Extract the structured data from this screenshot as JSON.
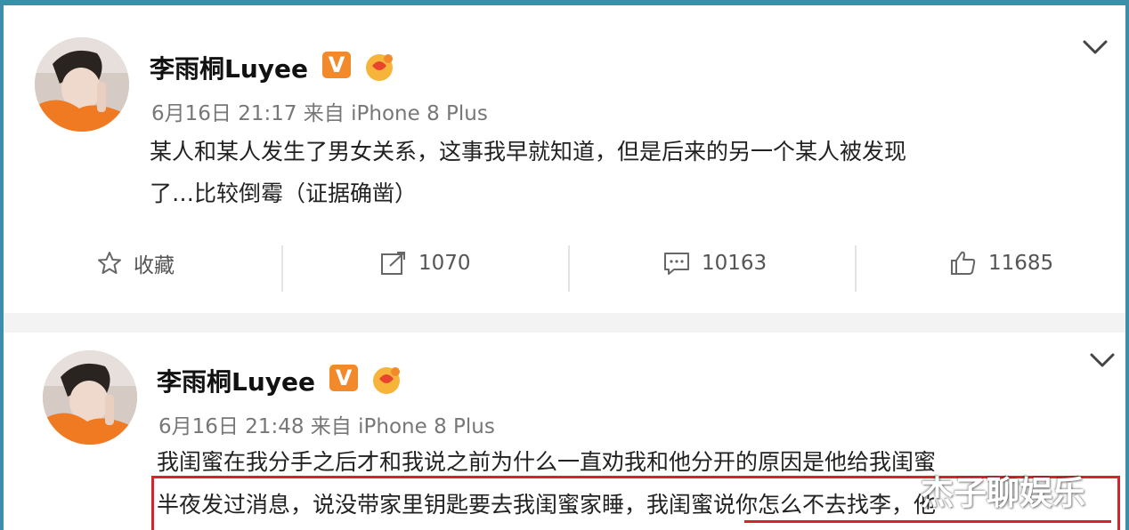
{
  "posts": [
    {
      "username": "李雨桐Luyee",
      "verified_badge": "V",
      "fan_badge_icon": "fan-badge-icon",
      "meta": "6月16日 21:17 来自 iPhone 8 Plus",
      "content_lines": [
        "某人和某人发生了男女关系，这事我早就知道，但是后来的另一个某人被发现",
        "了…比较倒霉（证据确凿）"
      ],
      "actions": {
        "favorite_label": "收藏",
        "repost_count": "1070",
        "comment_count": "10163",
        "like_count": "11685"
      }
    },
    {
      "username": "李雨桐Luyee",
      "verified_badge": "V",
      "fan_badge_icon": "fan-badge-icon",
      "meta": "6月16日 21:48 来自 iPhone 8 Plus",
      "content_lines": [
        "我闺蜜在我分手之后才和我说之前为什么一直劝我和他分开的原因是他给我闺蜜",
        "半夜发过消息，说没带家里钥匙要去我闺蜜家睡，我闺蜜说你怎么不去找李，他"
      ]
    }
  ],
  "watermark": "杰子聊娱乐",
  "colors": {
    "accent_frame": "#3d8ea8",
    "verified_orange": "#f28a2c",
    "highlight_red": "#d7232b"
  }
}
